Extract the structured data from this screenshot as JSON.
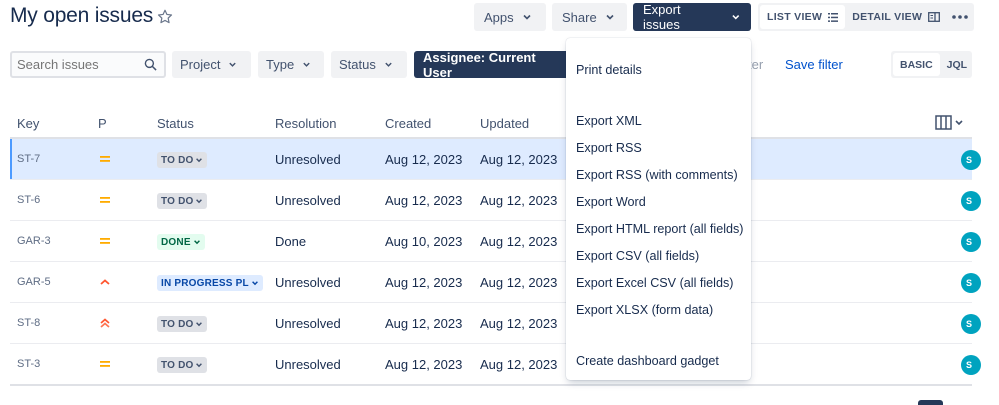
{
  "page": {
    "title": "My open issues"
  },
  "toolbar": {
    "apps_label": "Apps",
    "share_label": "Share",
    "export_label": "Export issues",
    "list_view_label": "LIST VIEW",
    "detail_view_label": "DETAIL VIEW"
  },
  "filters": {
    "search_placeholder": "Search issues",
    "project_label": "Project",
    "type_label": "Type",
    "status_label": "Status",
    "assignee_label": "Assignee: Current User",
    "hidden_partial_label": "ter",
    "save_filter_label": "Save filter",
    "basic_label": "BASIC",
    "jql_label": "JQL"
  },
  "table": {
    "columns": [
      "Key",
      "P",
      "Status",
      "Resolution",
      "Created",
      "Updated"
    ],
    "rows": [
      {
        "key": "ST-7",
        "priority": "medium",
        "status": "TO DO",
        "status_type": "todo",
        "resolution": "Unresolved",
        "created": "Aug 12, 2023",
        "updated": "Aug 12, 2023",
        "avatar": "S"
      },
      {
        "key": "ST-6",
        "priority": "medium",
        "status": "TO DO",
        "status_type": "todo",
        "resolution": "Unresolved",
        "created": "Aug 12, 2023",
        "updated": "Aug 12, 2023",
        "avatar": "S"
      },
      {
        "key": "GAR-3",
        "priority": "medium",
        "status": "DONE",
        "status_type": "done",
        "resolution": "Done",
        "created": "Aug 10, 2023",
        "updated": "Aug 12, 2023",
        "avatar": "S"
      },
      {
        "key": "GAR-5",
        "priority": "high",
        "status": "IN PROGRESS PL",
        "status_type": "progress",
        "resolution": "Unresolved",
        "created": "Aug 12, 2023",
        "updated": "Aug 12, 2023",
        "avatar": "S"
      },
      {
        "key": "ST-8",
        "priority": "highest",
        "status": "TO DO",
        "status_type": "todo",
        "resolution": "Unresolved",
        "created": "Aug 12, 2023",
        "updated": "Aug 12, 2023",
        "avatar": "S"
      },
      {
        "key": "ST-3",
        "priority": "medium",
        "status": "TO DO",
        "status_type": "todo",
        "resolution": "Unresolved",
        "created": "Aug 12, 2023",
        "updated": "Aug 12, 2023",
        "avatar": "S"
      }
    ]
  },
  "export_menu": {
    "items": [
      "Print details",
      "Export XML",
      "Export RSS",
      "Export RSS (with comments)",
      "Export Word",
      "Export HTML report (all fields)",
      "Export CSV (all fields)",
      "Export Excel CSV (all fields)",
      "Export XLSX (form data)",
      "Create dashboard gadget"
    ]
  },
  "colors": {
    "primary_dark": "#253858",
    "selected_row": "#deebff",
    "link": "#0052cc",
    "priority_medium": "#ffab00",
    "priority_high": "#ff5630",
    "avatar": "#00a3bf"
  }
}
